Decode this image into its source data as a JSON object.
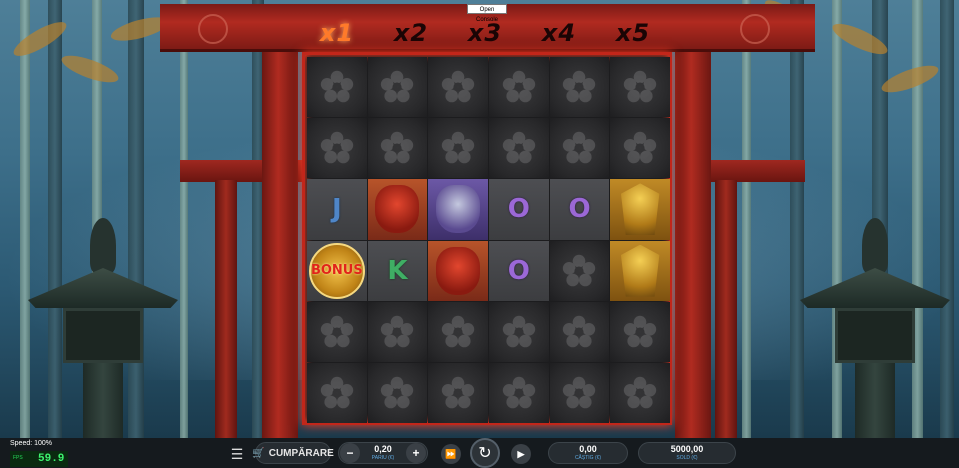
{
  "console": {
    "label": "Open Console"
  },
  "multipliers": [
    {
      "label": "x1",
      "active": true
    },
    {
      "label": "x2",
      "active": false
    },
    {
      "label": "x3",
      "active": false
    },
    {
      "label": "x4",
      "active": false
    },
    {
      "label": "x5",
      "active": false
    }
  ],
  "grid": {
    "rows": [
      [
        "blank",
        "blank",
        "blank",
        "blank",
        "blank",
        "blank"
      ],
      [
        "blank",
        "blank",
        "blank",
        "blank",
        "blank",
        "blank"
      ],
      [
        "J",
        "red-fox-mask",
        "purple-mask",
        "O",
        "O",
        "samurai"
      ],
      [
        "bonus",
        "K",
        "red-oni-mask",
        "O",
        "blank",
        "samurai"
      ],
      [
        "blank",
        "blank",
        "blank",
        "blank",
        "blank",
        "blank"
      ],
      [
        "blank",
        "blank",
        "blank",
        "blank",
        "blank",
        "blank"
      ]
    ],
    "symbols": {
      "J": "J",
      "K": "K",
      "O": "O",
      "bonus": "BONUS"
    }
  },
  "bottom_bar": {
    "speed": "Speed: 100%",
    "fps_label": "FPS",
    "fps_value": "59.9",
    "buy_label": "CUMPĂRARE",
    "bet_value": "0,20",
    "bet_label": "PARIU (€)",
    "win_value": "0,00",
    "win_label": "CÂȘTIG (€)",
    "balance_value": "5000,00",
    "balance_label": "SOLD (€)"
  },
  "colors": {
    "frame": "#c2261a",
    "active_multiplier": "#ff7a2a",
    "label_blue": "#5fa9e0"
  }
}
